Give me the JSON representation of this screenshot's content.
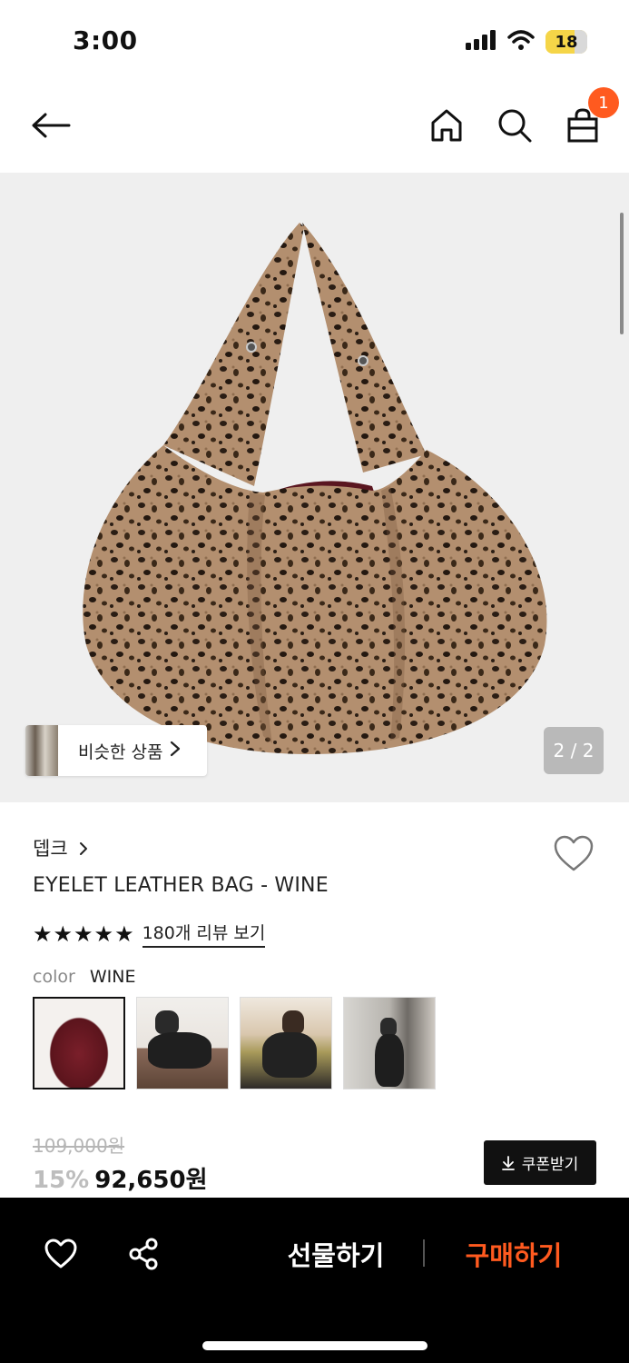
{
  "status_bar": {
    "time": "3:00",
    "battery": "18"
  },
  "nav": {
    "cart_count": "1"
  },
  "hero": {
    "similar_label": "비슷한 상품",
    "page_counter": "2 / 2"
  },
  "product": {
    "brand": "뎁크",
    "title": "EYELET LEATHER BAG - WINE",
    "stars": "★★★★★",
    "rating": 5,
    "review_link": "180개 리뷰 보기",
    "color_label": "color",
    "color_value": "WINE",
    "price_original": "109,000원",
    "discount": "15%",
    "price_sale": "92,650원",
    "coupon_label": "쿠폰받기"
  },
  "bottom_bar": {
    "gift_label": "선물하기",
    "buy_label": "구매하기"
  },
  "colors": {
    "accent": "#ff5a1f",
    "hero_bg": "#efefef",
    "bottom_bar": "#000000"
  },
  "icons": [
    "back-arrow-icon",
    "home-icon",
    "search-icon",
    "shopping-bag-icon",
    "heart-icon",
    "share-icon",
    "chevron-right-icon",
    "download-icon",
    "signal-icon",
    "wifi-icon"
  ]
}
